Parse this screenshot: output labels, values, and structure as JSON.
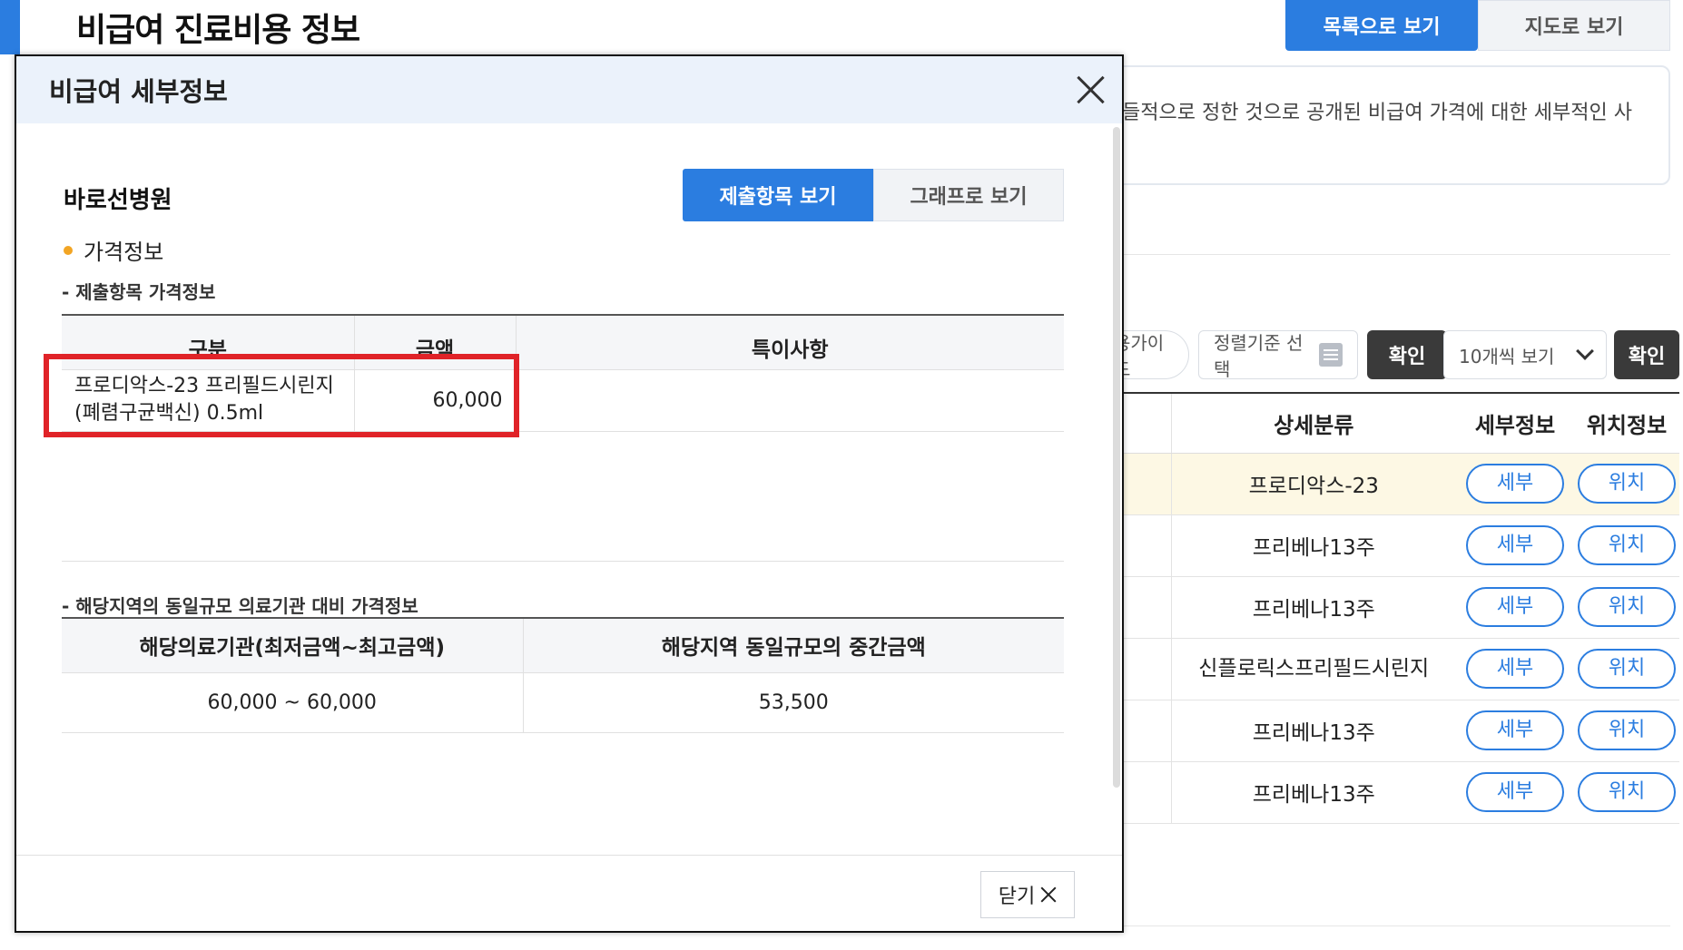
{
  "page": {
    "title": "비급여 진료비용 정보",
    "view_toggle": {
      "list": "목록으로 보기",
      "map": "지도로 보기"
    },
    "notice_text": "들적으로 정한 것으로 공개된 비급여 가격에 대한 세부적인 사",
    "controls": {
      "guide": "용가이드",
      "sort_placeholder": "정렬기준 선택",
      "confirm": "확인",
      "page_size": "10개씩 보기",
      "confirm2": "확인"
    },
    "result_table": {
      "headers": [
        "",
        "상세분류",
        "세부정보",
        "위치정보"
      ],
      "detail_label": "세부",
      "location_label": "위치",
      "rows": [
        {
          "category": "프로디악스-23",
          "highlight": true
        },
        {
          "category": "프리베나13주",
          "highlight": false
        },
        {
          "category": "프리베나13주",
          "highlight": false
        },
        {
          "category": "신플로릭스프리필드시린지",
          "highlight": false
        },
        {
          "category": "프리베나13주",
          "highlight": false
        },
        {
          "category": "프리베나13주",
          "highlight": false
        }
      ]
    }
  },
  "modal": {
    "title": "비급여 세부정보",
    "hospital_name": "바로선병원",
    "tabs": {
      "items": "제출항목 보기",
      "graph": "그래프로 보기"
    },
    "section_heading": "가격정보",
    "sub_heading_1": "- 제출항목 가격정보",
    "price_table": {
      "headers": [
        "구분",
        "금액",
        "특이사항"
      ],
      "rows": [
        {
          "item": "프로디악스-23 프리필드시린지(폐렴구균백신) 0.5ml",
          "amount": "60,000",
          "note": ""
        }
      ]
    },
    "sub_heading_2": "- 해당지역의 동일규모 의료기관 대비 가격정보",
    "compare_table": {
      "headers": [
        "해당의료기관(최저금액~최고금액)",
        "해당지역 동일규모의 중간금액"
      ],
      "range": "60,000 ~ 60,000",
      "median": "53,500"
    },
    "close_label": "닫기"
  },
  "colors": {
    "primary": "#2b7de0",
    "highlight_border": "#e02328",
    "bullet": "#f2a524",
    "row_highlight": "#fdf8e4"
  }
}
